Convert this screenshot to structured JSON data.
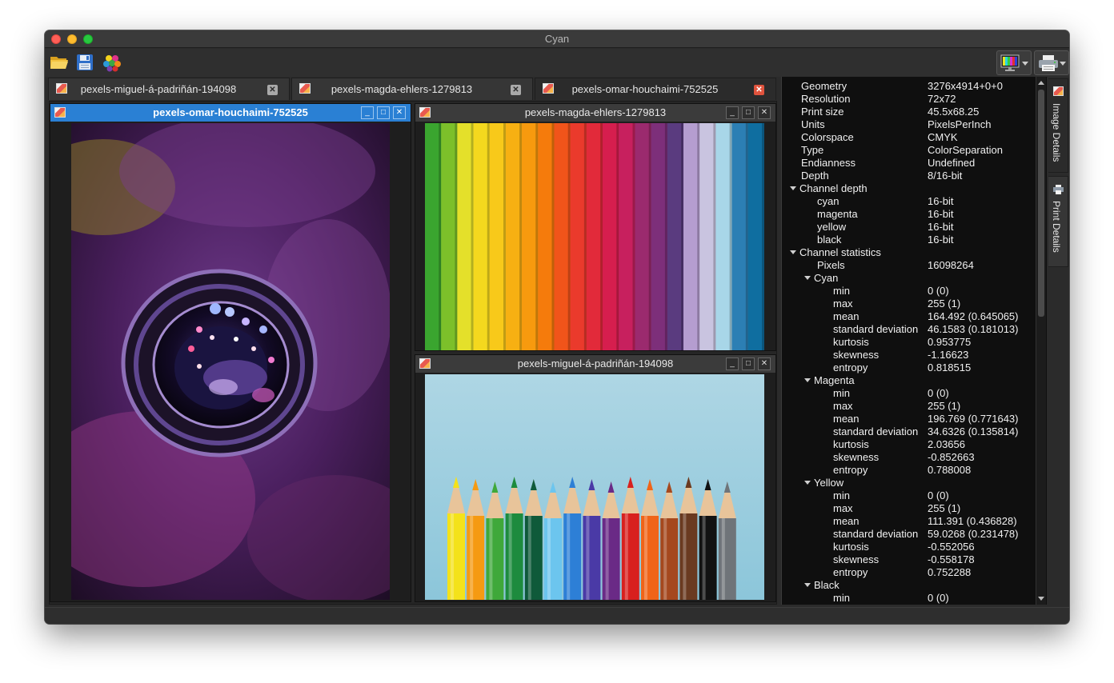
{
  "window": {
    "title": "Cyan"
  },
  "toolbar": {
    "open_icon": "folder-open-icon",
    "save_icon": "floppy-save-icon",
    "colors_icon": "color-palette-icon",
    "display_icon": "monitor-icon",
    "print_icon": "printer-icon"
  },
  "tabs": [
    {
      "label": "pexels-miguel-á-padriñán-194098"
    },
    {
      "label": "pexels-magda-ehlers-1279813"
    },
    {
      "label": "pexels-omar-houchaimi-752525"
    }
  ],
  "subwindows": [
    {
      "title": "pexels-omar-houchaimi-752525",
      "state": "active"
    },
    {
      "title": "pexels-magda-ehlers-1279813",
      "state": "inactive"
    },
    {
      "title": "pexels-miguel-á-padriñán-194098",
      "state": "inactive"
    }
  ],
  "details": {
    "top": [
      {
        "k": "Geometry",
        "v": "3276x4914+0+0"
      },
      {
        "k": "Resolution",
        "v": "72x72"
      },
      {
        "k": "Print size",
        "v": "45.5x68.25"
      },
      {
        "k": "Units",
        "v": "PixelsPerInch"
      },
      {
        "k": "Colorspace",
        "v": "CMYK"
      },
      {
        "k": "Type",
        "v": "ColorSeparation"
      },
      {
        "k": "Endianness",
        "v": "Undefined"
      },
      {
        "k": "Depth",
        "v": "8/16-bit"
      }
    ],
    "channel_depth_label": "Channel depth",
    "channel_depth": [
      {
        "k": "cyan",
        "v": "16-bit"
      },
      {
        "k": "magenta",
        "v": "16-bit"
      },
      {
        "k": "yellow",
        "v": "16-bit"
      },
      {
        "k": "black",
        "v": "16-bit"
      }
    ],
    "channel_stats_label": "Channel statistics",
    "pixels": {
      "k": "Pixels",
      "v": "16098264"
    },
    "cyan_label": "Cyan",
    "cyan": [
      {
        "k": "min",
        "v": "0  (0)"
      },
      {
        "k": "max",
        "v": "255 (1)"
      },
      {
        "k": "mean",
        "v": "164.492 (0.645065)"
      },
      {
        "k": "standard deviation",
        "v": "46.1583 (0.181013)"
      },
      {
        "k": "kurtosis",
        "v": "0.953775"
      },
      {
        "k": "skewness",
        "v": "-1.16623"
      },
      {
        "k": "entropy",
        "v": "0.818515"
      }
    ],
    "magenta_label": "Magenta",
    "magenta": [
      {
        "k": "min",
        "v": "0  (0)"
      },
      {
        "k": "max",
        "v": "255 (1)"
      },
      {
        "k": "mean",
        "v": "196.769 (0.771643)"
      },
      {
        "k": "standard deviation",
        "v": "34.6326 (0.135814)"
      },
      {
        "k": "kurtosis",
        "v": "2.03656"
      },
      {
        "k": "skewness",
        "v": "-0.852663"
      },
      {
        "k": "entropy",
        "v": "0.788008"
      }
    ],
    "yellow_label": "Yellow",
    "yellow": [
      {
        "k": "min",
        "v": "0  (0)"
      },
      {
        "k": "max",
        "v": "255 (1)"
      },
      {
        "k": "mean",
        "v": "111.391 (0.436828)"
      },
      {
        "k": "standard deviation",
        "v": "59.0268 (0.231478)"
      },
      {
        "k": "kurtosis",
        "v": "-0.552056"
      },
      {
        "k": "skewness",
        "v": "-0.558178"
      },
      {
        "k": "entropy",
        "v": "0.752288"
      }
    ],
    "black_label": "Black",
    "black": [
      {
        "k": "min",
        "v": "0  (0)"
      }
    ]
  },
  "side_tabs": [
    {
      "label": "Image Details"
    },
    {
      "label": "Print Details"
    }
  ],
  "colors": {
    "active_titlebar": "#2a80d4",
    "close_tab_active": "#e0533d",
    "paper_strips": [
      "#3aa52f",
      "#7cc02a",
      "#e4e02a",
      "#f4d81e",
      "#f8c91a",
      "#f7b012",
      "#f79a0e",
      "#f57b0c",
      "#f1541a",
      "#ea3a2c",
      "#e22a3a",
      "#d61e4e",
      "#c7205e",
      "#9b2a6e",
      "#7d2f7a",
      "#5a3b7f",
      "#b59dd0",
      "#c9c4e0",
      "#a8d6e8",
      "#2c7fb4",
      "#0f6ea0"
    ],
    "pencils": [
      "#f4e21a",
      "#f59a12",
      "#3fa83a",
      "#1d8b3e",
      "#0f5a3a",
      "#6cc5ee",
      "#2d7fd6",
      "#4a3aa6",
      "#6a2a86",
      "#d8201e",
      "#f06418",
      "#a5481e",
      "#6a3a20",
      "#121212",
      "#6f7479"
    ]
  }
}
